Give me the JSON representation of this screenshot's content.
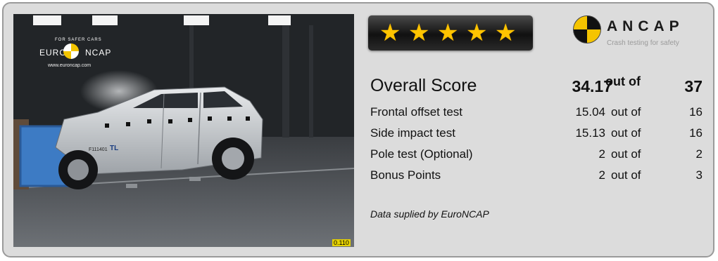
{
  "photo": {
    "euroncap_brand": "EURO NCAP",
    "euroncap_arc_text": "FOR SAFER CARS",
    "euroncap_url": "www.euroncap.com",
    "frame_counter": "0.110",
    "car_plate": "F111401",
    "car_badge": "TL"
  },
  "rating": {
    "stars": 5,
    "star_color": "#ffc400"
  },
  "ancap": {
    "brand": "ANCAP",
    "tagline": "Crash testing for safety"
  },
  "scores": {
    "overall": {
      "label": "Overall Score",
      "value": "34.17",
      "out_of": "out of",
      "max": "37"
    },
    "rows": [
      {
        "label": "Frontal offset test",
        "value": "15.04",
        "out_of": "out of",
        "max": "16"
      },
      {
        "label": "Side impact test",
        "value": "15.13",
        "out_of": "out of",
        "max": "16"
      },
      {
        "label": "Pole test (Optional)",
        "value": "2",
        "out_of": "out of",
        "max": "2"
      },
      {
        "label": "Bonus Points",
        "value": "2",
        "out_of": "out of",
        "max": "3"
      }
    ]
  },
  "footer_note": "Data suplied by EuroNCAP"
}
